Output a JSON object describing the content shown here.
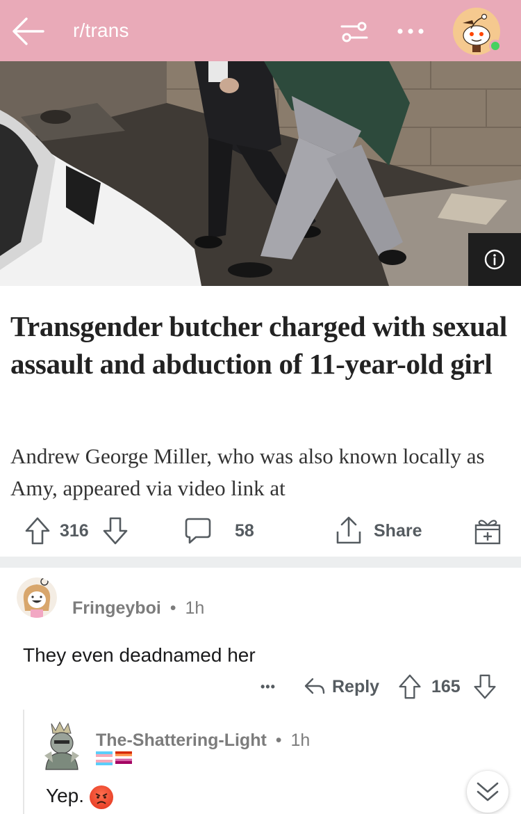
{
  "header": {
    "subreddit": "r/trans",
    "background": "#e9aab8"
  },
  "article": {
    "headline": "Transgender butcher charged with sexual assault and abduction of 11-year-old girl",
    "summary": "Andrew George Miller, who was also known locally as Amy, appeared via video link at"
  },
  "post_actions": {
    "upvotes": "316",
    "comments": "58",
    "share_label": "Share"
  },
  "comments": [
    {
      "author": "Fringeyboi",
      "separator": "•",
      "age": "1h",
      "body": "They even deadnamed her",
      "more": "•••",
      "reply_label": "Reply",
      "votes": "165"
    },
    {
      "author": "The-Shattering-Light",
      "separator": "•",
      "age": "1h",
      "body": "Yep.",
      "emoji": "angry-face-emoji",
      "flair_colors": [
        "#5bcefa",
        "#f5a9b8",
        "#ffffff",
        "#d62900",
        "#ff9a56",
        "#d462a6",
        "#a30262"
      ]
    }
  ],
  "icons": {
    "back": "back-arrow-icon",
    "filter": "sort-filter-icon",
    "more": "more-dots-icon",
    "info": "info-icon",
    "upvote": "upvote-arrow-icon",
    "downvote": "downvote-arrow-icon",
    "comment": "comment-bubble-icon",
    "share": "share-icon",
    "award": "award-gift-icon",
    "reply": "reply-arrow-icon",
    "scroll": "chevron-double-down-icon"
  }
}
